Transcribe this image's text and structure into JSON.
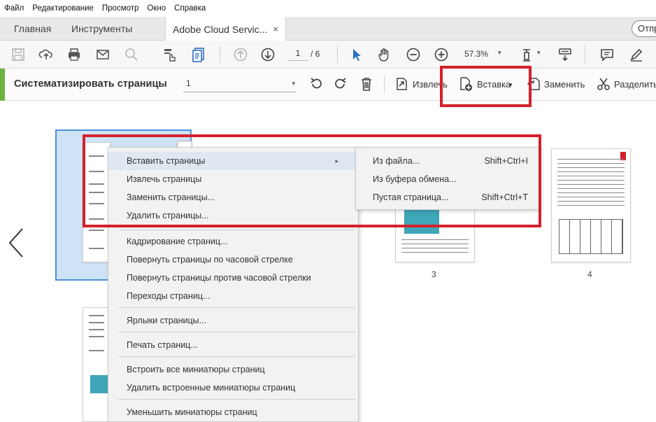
{
  "menubar": [
    "Файл",
    "Редактирование",
    "Просмотр",
    "Окно",
    "Справка"
  ],
  "tabs": {
    "home": "Главная",
    "tools": "Инструменты",
    "document": "Adobe Cloud Servic...",
    "close": "×",
    "share": "Отпр"
  },
  "toolbar": {
    "page_current": "1",
    "page_total": "/ 6",
    "zoom": "57.3%",
    "caret": "▾"
  },
  "organize": {
    "title": "Систематизировать страницы",
    "range_value": "1",
    "caret": "▾",
    "extract_label": "Извлечь",
    "insert_label": "Вставка",
    "insert_caret": "▾",
    "replace_label": "Заменить",
    "split_label": "Разделить"
  },
  "thumbnails": {
    "page3_label": "3",
    "page4_label": "4"
  },
  "context_menu": {
    "items": [
      "Вставить страницы",
      "Извлечь страницы",
      "Заменить страницы...",
      "Удалить страницы...",
      "Кадрирование страниц...",
      "Повернуть страницы по часовой стрелке",
      "Повернуть страницы против часовой стрелки",
      "Переходы страниц...",
      "Ярлыки страницы...",
      "Печать страниц...",
      "Встроить все миниатюры страниц",
      "Удалить встроенные миниатюры страниц",
      "Уменьшить миниатюры страниц"
    ],
    "submenu_arrow": "▸"
  },
  "submenu": {
    "items": [
      {
        "label": "Из файла...",
        "shortcut": "Shift+Ctrl+I"
      },
      {
        "label": "Из буфера обмена...",
        "shortcut": ""
      },
      {
        "label": "Пустая страница...",
        "shortcut": "Shift+Ctrl+T"
      }
    ]
  },
  "colors": {
    "highlight_red": "#d5202b",
    "organize_accent": "#6cb33e",
    "selection_blue": "#4f8fd6"
  }
}
